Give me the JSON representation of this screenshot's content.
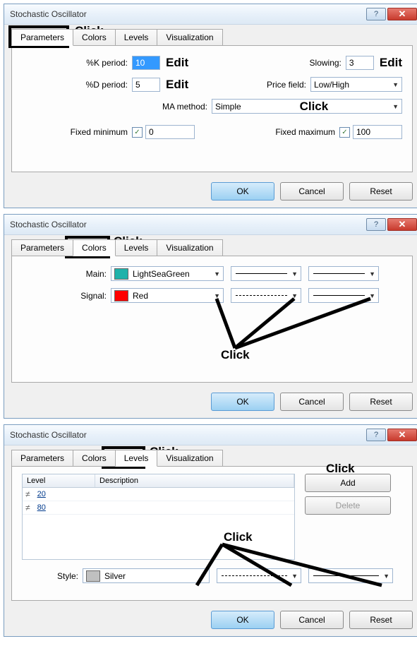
{
  "annotations": {
    "click": "Click",
    "edit": "Edit"
  },
  "common": {
    "title": "Stochastic Oscillator",
    "tabs": {
      "parameters": "Parameters",
      "colors": "Colors",
      "levels": "Levels",
      "visualization": "Visualization"
    },
    "buttons": {
      "ok": "OK",
      "cancel": "Cancel",
      "reset": "Reset",
      "add": "Add",
      "delete": "Delete"
    }
  },
  "panel1": {
    "labels": {
      "k_period": "%K period:",
      "d_period": "%D period:",
      "slowing": "Slowing:",
      "price_field": "Price field:",
      "ma_method": "MA method:",
      "fixed_min": "Fixed minimum",
      "fixed_max": "Fixed maximum"
    },
    "values": {
      "k_period": "10",
      "d_period": "5",
      "slowing": "3",
      "price_field": "Low/High",
      "ma_method": "Simple",
      "fixed_min": "0",
      "fixed_max": "100"
    }
  },
  "panel2": {
    "labels": {
      "main": "Main:",
      "signal": "Signal:"
    },
    "values": {
      "main_color_name": "LightSeaGreen",
      "main_color_hex": "#20B2AA",
      "signal_color_name": "Red",
      "signal_color_hex": "#FF0000"
    }
  },
  "panel3": {
    "headers": {
      "level": "Level",
      "description": "Description"
    },
    "rows": [
      {
        "level": "20",
        "description": ""
      },
      {
        "level": "80",
        "description": ""
      }
    ],
    "style_label": "Style:",
    "style_value": "Silver",
    "style_hex": "#C0C0C0"
  }
}
